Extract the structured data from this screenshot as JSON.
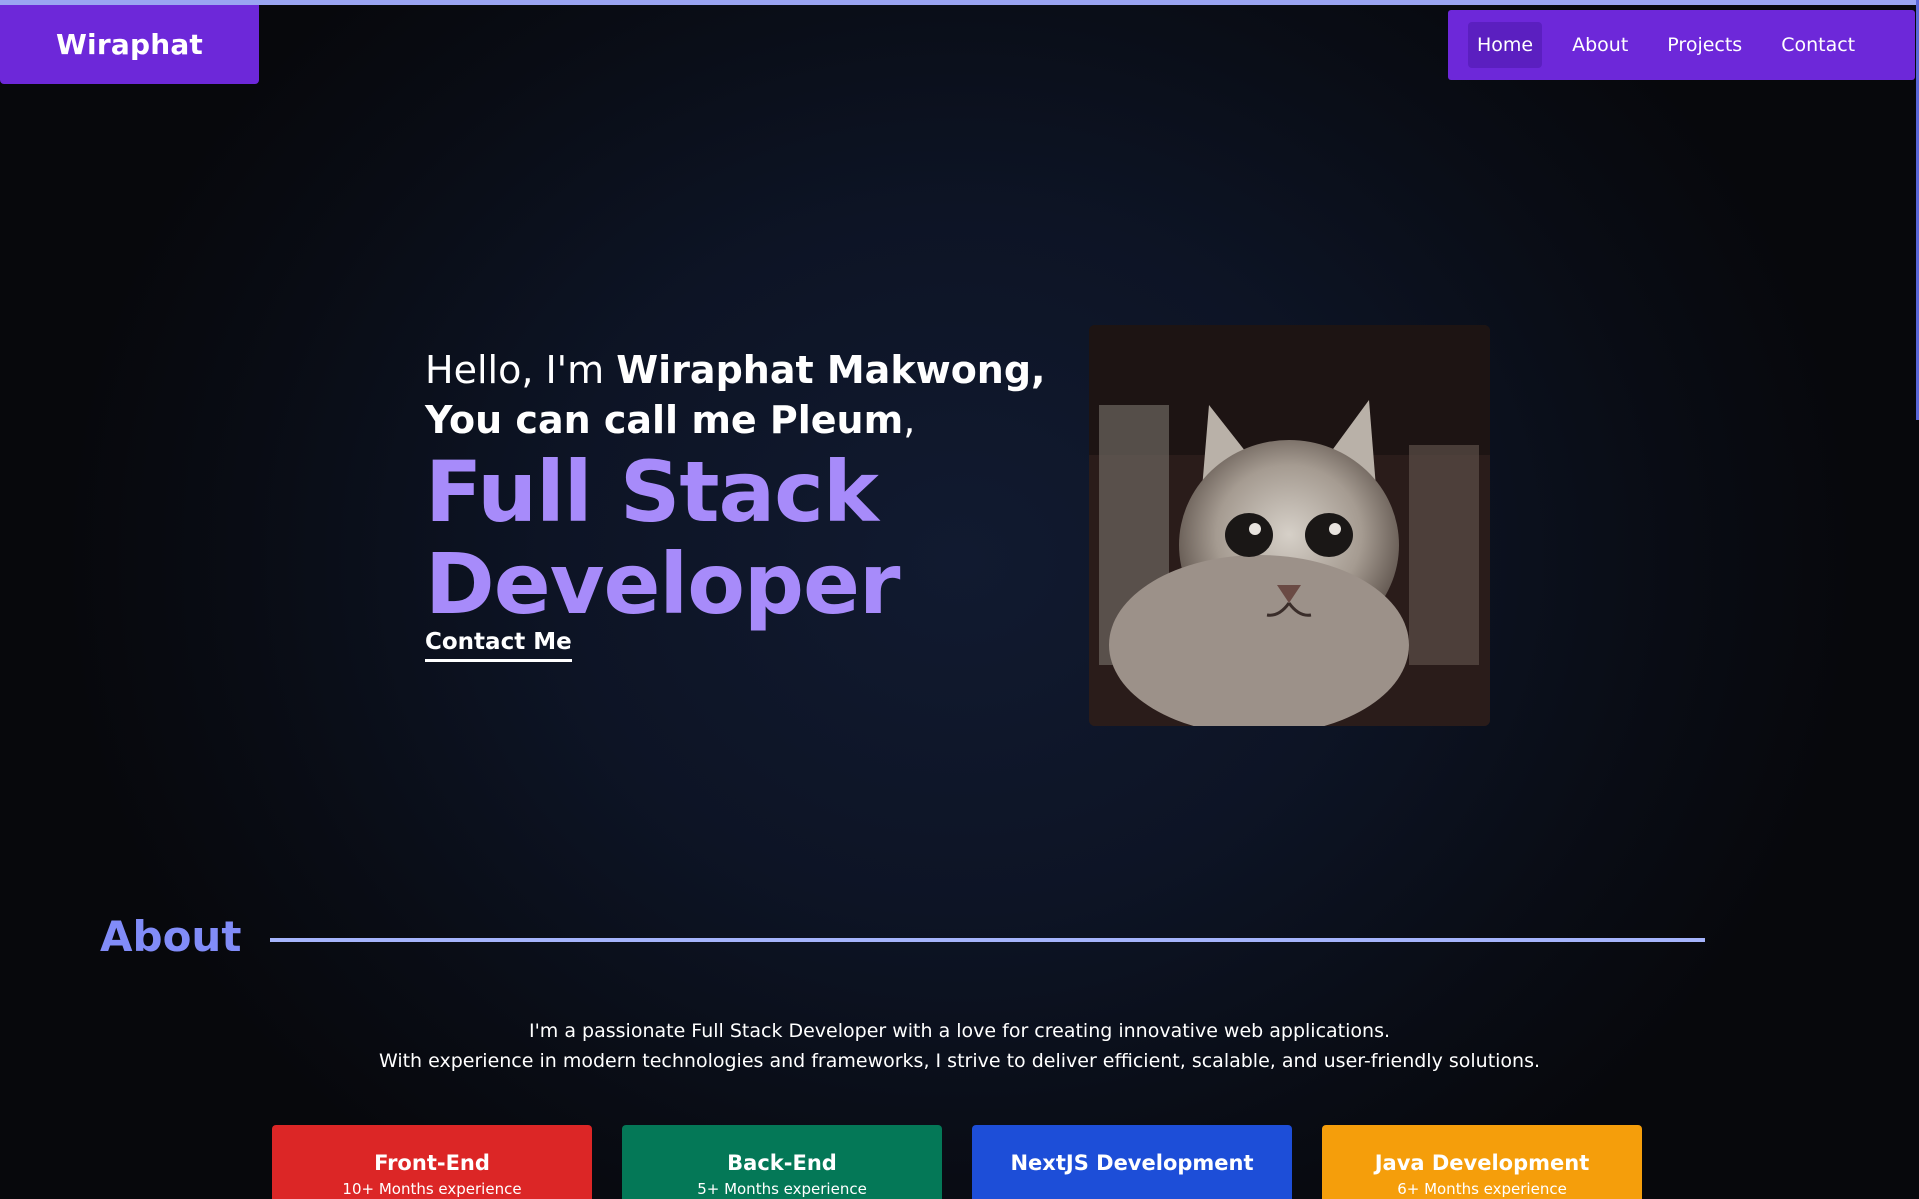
{
  "brand": {
    "name": "Wiraphat"
  },
  "nav": {
    "items": [
      {
        "label": "Home",
        "active": true
      },
      {
        "label": "About",
        "active": false
      },
      {
        "label": "Projects",
        "active": false
      },
      {
        "label": "Contact",
        "active": false
      }
    ]
  },
  "hero": {
    "greeting": "Hello, I'm",
    "name": "Wiraphat Makwong,",
    "nickname_line": "You can call me Pleum",
    "nickname_comma": ",",
    "role_line1": "Full Stack",
    "role_line2": "Developer",
    "cta": "Contact Me",
    "photo_icon": "cat-photo"
  },
  "about": {
    "heading": "About",
    "description_line1": "I'm a passionate Full Stack Developer with a love for creating innovative web applications.",
    "description_line2": "With experience in modern technologies and frameworks, I strive to deliver efficient, scalable, and user-friendly solutions.",
    "cards": [
      {
        "title": "Front-End",
        "subtitle": "10+ Months experience",
        "color": "#dc2626"
      },
      {
        "title": "Back-End",
        "subtitle": "5+ Months experience",
        "color": "#047857"
      },
      {
        "title": "NextJS Development",
        "subtitle": "",
        "color": "#1d4ed8"
      },
      {
        "title": "Java Development",
        "subtitle": "6+ Months experience",
        "color": "#f59e0b"
      }
    ]
  },
  "colors": {
    "accent_purple": "#6d28d9",
    "role_text": "#a78bfa",
    "about_heading": "#818cf8"
  }
}
